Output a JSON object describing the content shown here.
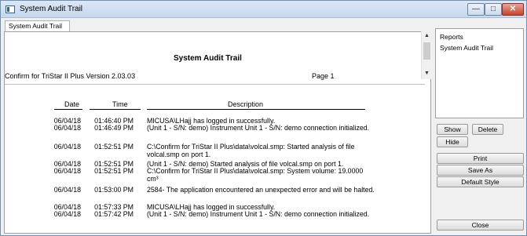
{
  "window": {
    "title": "System Audit Trail",
    "controls": {
      "minimize": "—",
      "maximize": "□",
      "close": "✕"
    }
  },
  "tab": {
    "label": "System Audit Trail"
  },
  "report": {
    "title": "System Audit Trail",
    "version": "Confirm for TriStar II Plus Version 2.03.03",
    "page": "Page 1",
    "columns": [
      "Date",
      "Time",
      "Description"
    ],
    "rows": [
      {
        "date": "06/04/18",
        "time": "01:46:40 PM",
        "desc": "MICUSA\\LHajj has logged in successfully."
      },
      {
        "date": "06/04/18",
        "time": "01:46:49 PM",
        "desc": "(Unit 1 - S/N: demo) Instrument Unit 1 - S/N: demo connection initialized."
      },
      {
        "date": "06/04/18",
        "time": "01:52:51 PM",
        "desc": "C:\\Confirm for TriStar II Plus\\data\\volcal.smp: Started analysis of file volcal.smp on port 1."
      },
      {
        "date": "06/04/18",
        "time": "01:52:51 PM",
        "desc": "(Unit 1 - S/N: demo) Started analysis of file volcal.smp on port 1."
      },
      {
        "date": "06/04/18",
        "time": "01:52:51 PM",
        "desc": "C:\\Confirm for TriStar II Plus\\data\\volcal.smp: System volume: 19.0000 cm³"
      },
      {
        "date": "06/04/18",
        "time": "01:53:00 PM",
        "desc": "2584- The application encountered an unexpected error and will be halted."
      },
      {
        "date": "06/04/18",
        "time": "01:57:33 PM",
        "desc": "MICUSA\\LHajj has logged in successfully."
      },
      {
        "date": "06/04/18",
        "time": "01:57:42 PM",
        "desc": "(Unit 1 - S/N: demo) Instrument Unit 1 - S/N: demo connection initialized."
      }
    ]
  },
  "scroll": {
    "up": "▲",
    "down": "▼"
  },
  "sidebar": {
    "list_header": "Reports",
    "list_item": "System Audit Trail",
    "buttons": {
      "show": "Show",
      "delete": "Delete",
      "hide": "Hide",
      "print": "Print",
      "save_as": "Save As",
      "default_style": "Default Style",
      "close": "Close"
    }
  }
}
